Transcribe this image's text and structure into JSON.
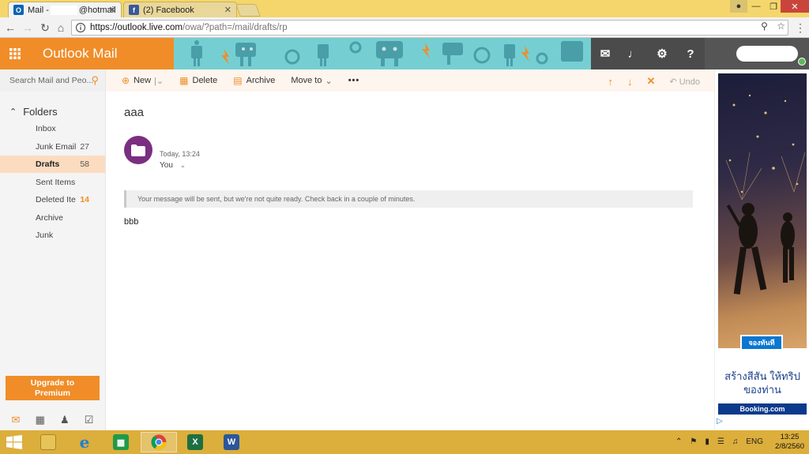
{
  "browser": {
    "tabs": [
      {
        "label": "Mail - ",
        "hidden_label": "@hotmail",
        "favicon": "O"
      },
      {
        "label": "(2) Facebook",
        "favicon": "f"
      }
    ],
    "url_host": "https://outlook.live.com",
    "url_path": "/owa/?path=/mail/drafts/rp"
  },
  "header": {
    "brand": "Outlook Mail",
    "accent": "#f08d28",
    "teal": "#5dc3c9"
  },
  "search": {
    "placeholder": "Search Mail and Peo..."
  },
  "toolbar": {
    "new_label": "New",
    "delete_label": "Delete",
    "archive_label": "Archive",
    "moveto_label": "Move to",
    "more_label": "•••",
    "undo_label": "Undo"
  },
  "nav": {
    "folders_label": "Folders",
    "items": [
      {
        "label": "Inbox",
        "count": ""
      },
      {
        "label": "Junk Email",
        "count": "27"
      },
      {
        "label": "Drafts",
        "count": "58"
      },
      {
        "label": "Sent Items",
        "count": ""
      },
      {
        "label": "Deleted Ite",
        "count": "14"
      },
      {
        "label": "Archive",
        "count": ""
      },
      {
        "label": "Junk",
        "count": ""
      }
    ],
    "upgrade_line1": "Upgrade to",
    "upgrade_line2": "Premium"
  },
  "message": {
    "subject": "aaa",
    "time": "Today, 13:24",
    "to": "You",
    "notice": "Your message will be sent, but we're not quite ready. Check back in a couple of minutes.",
    "body": "bbb"
  },
  "ad": {
    "button": "จองทันที",
    "line1": "สร้างสีสัน ให้ทริป",
    "line2": "ของท่าน",
    "brand": "Booking.com"
  },
  "taskbar": {
    "lang": "ENG",
    "time": "13:25",
    "date": "2/8/2560"
  }
}
